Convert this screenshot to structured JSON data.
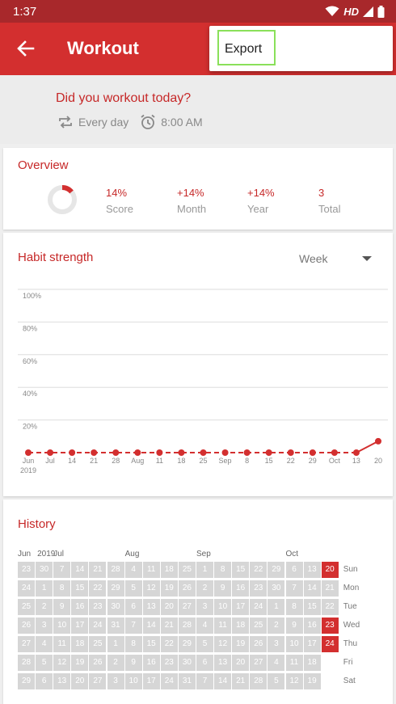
{
  "status_bar": {
    "time": "1:37",
    "network": "HD",
    "icons": [
      "wifi-icon",
      "signal-icon",
      "battery-icon"
    ]
  },
  "app_bar": {
    "title": "Workout",
    "back_icon": "arrow-back-icon"
  },
  "overflow_menu": {
    "items": [
      {
        "label": "Export"
      }
    ]
  },
  "header": {
    "question": "Did you workout today?",
    "frequency": "Every day",
    "reminder_time": "8:00 AM"
  },
  "overview": {
    "title": "Overview",
    "score_fraction": 0.14,
    "items": [
      {
        "value": "14%",
        "label": "Score"
      },
      {
        "value": "+14%",
        "label": "Month"
      },
      {
        "value": "+14%",
        "label": "Year"
      },
      {
        "value": "3",
        "label": "Total"
      }
    ]
  },
  "habit_strength": {
    "title": "Habit strength",
    "period": "Week"
  },
  "chart_data": {
    "type": "line",
    "y_ticks": [
      "100%",
      "80%",
      "60%",
      "40%",
      "20%"
    ],
    "ylim": [
      0,
      100
    ],
    "x": [
      "Jun 2019",
      "Jul",
      "14",
      "21",
      "28",
      "Aug",
      "11",
      "18",
      "25",
      "Sep",
      "8",
      "15",
      "22",
      "29",
      "Oct",
      "13",
      "20"
    ],
    "x_tick_labels": [
      "Jun",
      "Jul",
      "14",
      "21",
      "28",
      "Aug",
      "11",
      "18",
      "25",
      "Sep",
      "8",
      "15",
      "22",
      "29",
      "Oct",
      "13",
      "20"
    ],
    "x_year_label": "2019",
    "values": [
      0,
      0,
      0,
      0,
      0,
      0,
      0,
      0,
      0,
      0,
      0,
      0,
      0,
      0,
      0,
      0,
      7
    ],
    "grid": true,
    "color": "#d32f2f"
  },
  "history": {
    "title": "History",
    "months": [
      {
        "label": "Jun",
        "col": 0
      },
      {
        "label": "2019",
        "col": 1
      },
      {
        "label": "Jul",
        "col": 2
      },
      {
        "label": "Aug",
        "col": 6
      },
      {
        "label": "Sep",
        "col": 10
      },
      {
        "label": "Oct",
        "col": 15
      }
    ],
    "days_of_week": [
      "Sun",
      "Mon",
      "Tue",
      "Wed",
      "Thu",
      "Fri",
      "Sat"
    ],
    "columns": [
      [
        "23",
        "24",
        "25",
        "26",
        "27",
        "28",
        "29"
      ],
      [
        "30",
        "1",
        "2",
        "3",
        "4",
        "5",
        "6"
      ],
      [
        "7",
        "8",
        "9",
        "10",
        "11",
        "12",
        "13"
      ],
      [
        "14",
        "15",
        "16",
        "17",
        "18",
        "19",
        "20"
      ],
      [
        "21",
        "22",
        "23",
        "24",
        "25",
        "26",
        "27"
      ],
      [
        "28",
        "29",
        "30",
        "31",
        "1",
        "2",
        "3"
      ],
      [
        "4",
        "5",
        "6",
        "7",
        "8",
        "9",
        "10"
      ],
      [
        "11",
        "12",
        "13",
        "14",
        "15",
        "16",
        "17"
      ],
      [
        "18",
        "19",
        "20",
        "21",
        "22",
        "23",
        "24"
      ],
      [
        "25",
        "26",
        "27",
        "28",
        "29",
        "30",
        "31"
      ],
      [
        "1",
        "2",
        "3",
        "4",
        "5",
        "6",
        "7"
      ],
      [
        "8",
        "9",
        "10",
        "11",
        "12",
        "13",
        "14"
      ],
      [
        "15",
        "16",
        "17",
        "18",
        "19",
        "20",
        "21"
      ],
      [
        "22",
        "23",
        "24",
        "25",
        "26",
        "27",
        "28"
      ],
      [
        "29",
        "30",
        "1",
        "2",
        "3",
        "4",
        "5"
      ],
      [
        "6",
        "7",
        "8",
        "9",
        "10",
        "11",
        "12"
      ],
      [
        "13",
        "14",
        "15",
        "16",
        "17",
        "18",
        "19"
      ],
      [
        "20",
        "21",
        "22",
        "23",
        "24",
        "",
        ""
      ]
    ],
    "checked": [
      [
        17,
        0
      ],
      [
        17,
        3
      ],
      [
        17,
        4
      ]
    ],
    "colors": {
      "checked": "#d32f2f",
      "unchecked": "#d6d6d6"
    }
  }
}
